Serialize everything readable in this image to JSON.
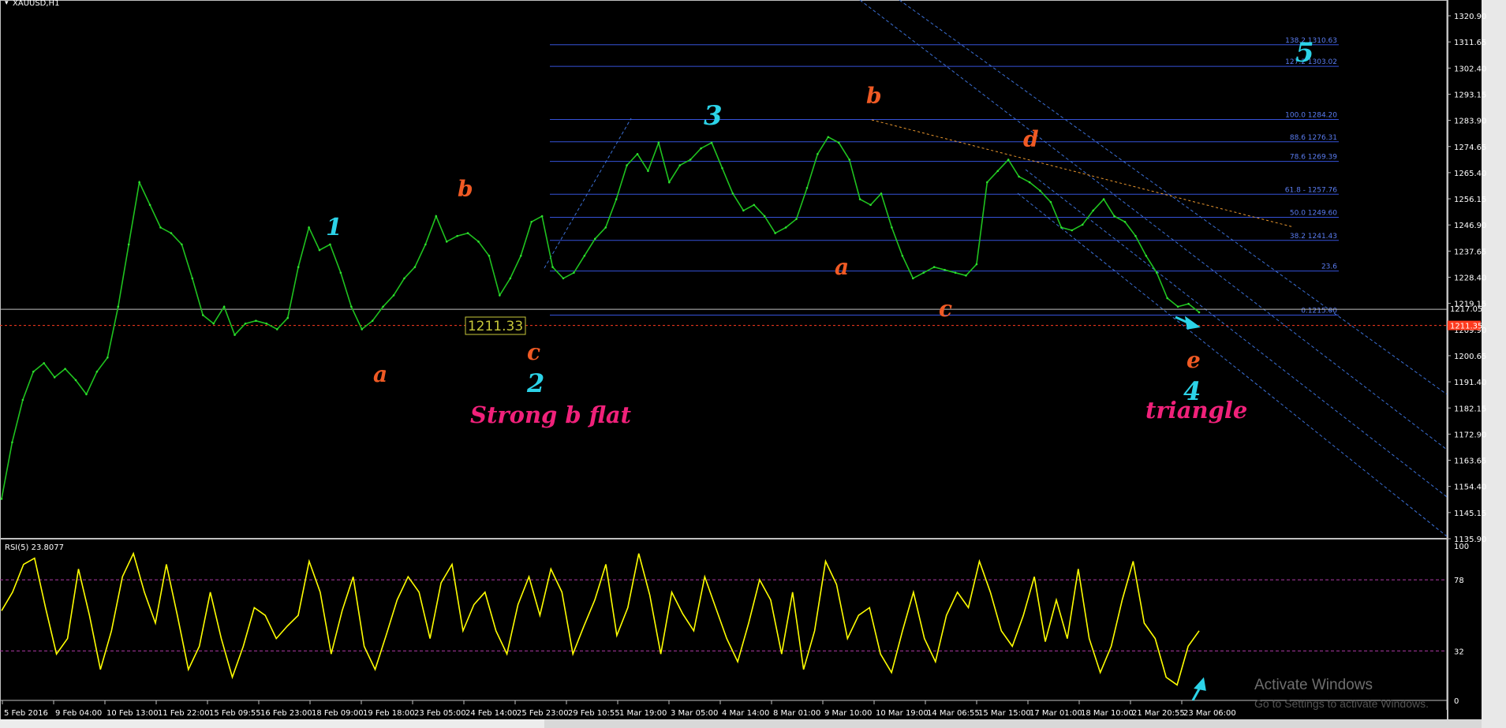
{
  "window": {
    "title": "XAUUSD,H1"
  },
  "price_panel": {
    "price_ticks": [
      "1320.90",
      "1311.65",
      "1302.40",
      "1293.15",
      "1283.90",
      "1274.65",
      "1265.40",
      "1256.15",
      "1246.90",
      "1237.65",
      "1228.40",
      "1219.15",
      "1209.90",
      "1200.65",
      "1191.40",
      "1182.15",
      "1172.90",
      "1163.65",
      "1154.40",
      "1145.15",
      "1135.90"
    ],
    "current_price_tag": "1211.35",
    "bid_tag": "1217.05",
    "price_box_label": "1211.33"
  },
  "fib_levels": [
    {
      "label": "138.2 1310.63"
    },
    {
      "label": "127.2 1303.02"
    },
    {
      "label": "100.0 1284.20"
    },
    {
      "label": "88.6 1276.31"
    },
    {
      "label": "78.6 1269.39"
    },
    {
      "label": "61.8 - 1257.76"
    },
    {
      "label": "50.0 1249.60"
    },
    {
      "label": "38.2 1241.43"
    },
    {
      "label": "23.6"
    },
    {
      "label": "0.1215.00"
    }
  ],
  "wave_labels": {
    "w1": "1",
    "w2": "2",
    "w3": "3",
    "w4": "4",
    "w5": "5",
    "a1": "a",
    "b1": "b",
    "c1": "c",
    "a2": "a",
    "b2": "b",
    "c2": "c",
    "d2": "d",
    "e2": "e",
    "pattern1": "Strong b flat",
    "pattern2": "triangle"
  },
  "rsi_panel": {
    "title": "RSI(5) 23.8077",
    "ticks": [
      "100",
      "78",
      "32",
      "0"
    ]
  },
  "time_axis": [
    "5 Feb 2016",
    "9 Feb 04:00",
    "10 Feb 13:00",
    "11 Feb 22:00",
    "15 Feb 09:55",
    "16 Feb 23:00",
    "18 Feb 09:00",
    "19 Feb 18:00",
    "23 Feb 05:00",
    "24 Feb 14:00",
    "25 Feb 23:00",
    "29 Feb 10:55",
    "1 Mar 19:00",
    "3 Mar 05:00",
    "4 Mar 14:00",
    "8 Mar 01:00",
    "9 Mar 10:00",
    "10 Mar 19:00",
    "14 Mar 06:55",
    "15 Mar 15:00",
    "17 Mar 01:00",
    "18 Mar 10:00",
    "21 Mar 20:55",
    "23 Mar 06:00"
  ],
  "watermark": {
    "line1": "Activate Windows",
    "line2": "Go to Settings to activate Windows."
  },
  "chart_data": {
    "type": "line",
    "title": "XAUUSD,H1",
    "x_tick_labels": [
      "5 Feb 2016",
      "9 Feb 04:00",
      "10 Feb 13:00",
      "11 Feb 22:00",
      "15 Feb 09:55",
      "16 Feb 23:00",
      "18 Feb 09:00",
      "19 Feb 18:00",
      "23 Feb 05:00",
      "24 Feb 14:00",
      "25 Feb 23:00",
      "29 Feb 10:55",
      "1 Mar 19:00",
      "3 Mar 05:00",
      "4 Mar 14:00",
      "8 Mar 01:00",
      "9 Mar 10:00",
      "10 Mar 19:00",
      "14 Mar 06:55",
      "15 Mar 15:00",
      "17 Mar 01:00",
      "18 Mar 10:00",
      "21 Mar 20:55",
      "23 Mar 06:00"
    ],
    "ylim": [
      1135.9,
      1320.9
    ],
    "series": [
      {
        "values": [
          1150,
          1170,
          1185,
          1195,
          1198,
          1193,
          1196,
          1192,
          1187,
          1195,
          1200,
          1218,
          1240,
          1262,
          1254,
          1246,
          1244,
          1240,
          1228,
          1215,
          1212,
          1218,
          1208,
          1212,
          1213,
          1212,
          1210,
          1214,
          1232,
          1246,
          1238,
          1240,
          1230,
          1218,
          1210,
          1213,
          1218,
          1222,
          1228,
          1232,
          1240,
          1250,
          1241,
          1243,
          1244,
          1241,
          1236,
          1222,
          1228,
          1236,
          1248,
          1250,
          1232,
          1228,
          1230,
          1236,
          1242,
          1246,
          1256,
          1268,
          1272,
          1266,
          1276,
          1262,
          1268,
          1270,
          1274,
          1276,
          1267,
          1258,
          1252,
          1254,
          1250,
          1244,
          1246,
          1249,
          1260,
          1272,
          1278,
          1276,
          1270,
          1256,
          1254,
          1258,
          1246,
          1236,
          1228,
          1230,
          1232,
          1231,
          1230,
          1229,
          1233,
          1262,
          1266,
          1270,
          1264,
          1262,
          1259,
          1255,
          1246,
          1245,
          1247,
          1252,
          1256,
          1250,
          1248,
          1243,
          1236,
          1230,
          1221,
          1218,
          1219,
          1216
        ]
      }
    ],
    "rsi": {
      "values": [
        58,
        70,
        88,
        92,
        60,
        30,
        40,
        85,
        55,
        20,
        45,
        80,
        95,
        70,
        50,
        88,
        55,
        20,
        35,
        70,
        40,
        15,
        35,
        60,
        55,
        40,
        48,
        55,
        90,
        70,
        30,
        58,
        80,
        35,
        20,
        42,
        65,
        80,
        70,
        40,
        76,
        88,
        45,
        62,
        70,
        45,
        30,
        62,
        80,
        55,
        85,
        70,
        30,
        48,
        65,
        88,
        42,
        60,
        95,
        68,
        30,
        70,
        56,
        45,
        80,
        60,
        40,
        25,
        50,
        78,
        65,
        30,
        70,
        20,
        45,
        90,
        75,
        40,
        55,
        60,
        30,
        18,
        45,
        70,
        40,
        25,
        55,
        70,
        60,
        90,
        70,
        45,
        35,
        55,
        80,
        38,
        65,
        40,
        85,
        40,
        18,
        35,
        65,
        90,
        50,
        40,
        15,
        10,
        35,
        45
      ]
    },
    "fib_prices": [
      1310.63,
      1303.02,
      1284.2,
      1276.31,
      1269.39,
      1257.76,
      1249.6,
      1241.43,
      1230.6,
      1215.0
    ],
    "current_price": 1211.35,
    "rsi_levels": [
      78,
      32
    ]
  }
}
